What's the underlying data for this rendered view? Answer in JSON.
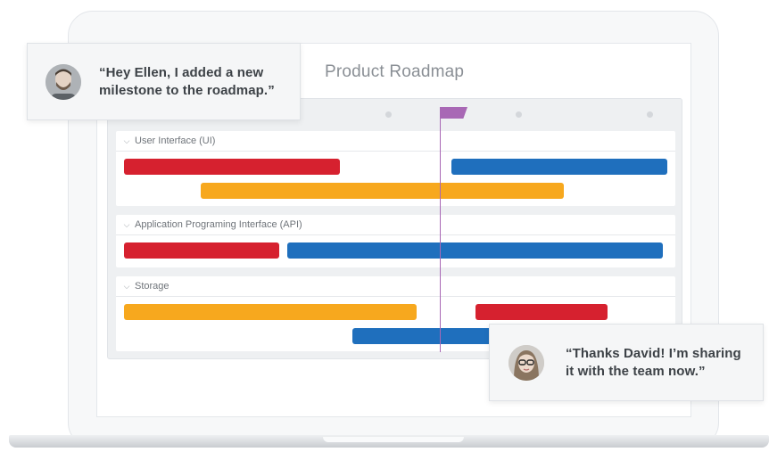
{
  "roadmap": {
    "title": "Product Roadmap",
    "groups": [
      {
        "label": "User Interface (UI)"
      },
      {
        "label": "Application Programing Interface (API)"
      },
      {
        "label": "Storage"
      }
    ]
  },
  "chat": {
    "message_1": "“Hey Ellen, I added a new milestone to the roadmap.”",
    "message_2": "“Thanks David! I’m sharing it with the team now.”"
  },
  "icons": {
    "collapse": "chevron-down-icon"
  },
  "colors": {
    "red": "#d6212f",
    "blue": "#1f6fbd",
    "orange": "#f7a81e",
    "milestone": "#a868b5"
  }
}
